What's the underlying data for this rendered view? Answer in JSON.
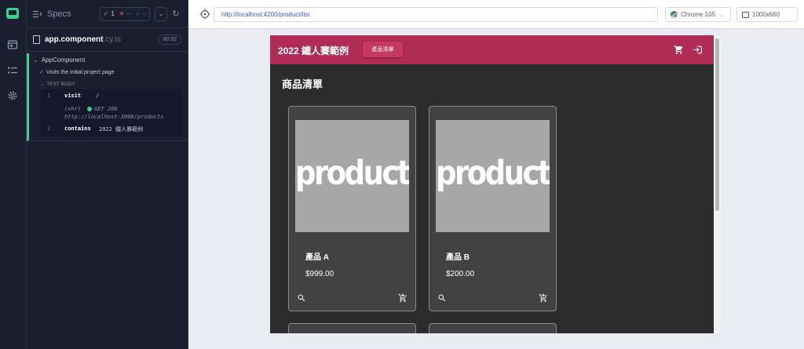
{
  "reporter": {
    "header": {
      "specs_label": "Specs",
      "passed": "1",
      "failed": "--",
      "pending": "--"
    },
    "file": {
      "name": "app.component",
      "ext": ".cy.ts",
      "duration": "00:02"
    },
    "suite": {
      "title": "AppComponent",
      "test": "Visits the initial project page",
      "body_label": "TEST BODY",
      "commands": [
        {
          "num": "1",
          "name": "visit",
          "arg": "/"
        },
        {
          "xhr_tag": "(xhr)",
          "xhr_status": "GET 200",
          "xhr_url": "http://localhost:3000/products"
        },
        {
          "num": "2",
          "name": "contains",
          "arg": "2022 鐵人賽範例"
        }
      ]
    }
  },
  "browserbar": {
    "url": "http://localhost:4200/product/list",
    "browser": "Chrome 105",
    "viewport": "1000x660"
  },
  "app": {
    "title": "2022 鐵人賽範例",
    "nav_button": "產品清單",
    "page_title": "商品清單",
    "products": [
      {
        "image_text": "product",
        "name": "產品 A",
        "price": "$999.00"
      },
      {
        "image_text": "product",
        "name": "產品 B",
        "price": "$200.00"
      }
    ]
  },
  "colors": {
    "toolbar": "#b02c55",
    "pass": "#3ccf8e",
    "fail": "#ef5a6f",
    "reporter_bg": "#1b1e2e"
  },
  "icons": {
    "rail": [
      "runs-icon",
      "spec-list-icon",
      "settings-icon"
    ],
    "toolbar": [
      "cart-icon",
      "login-icon"
    ],
    "card": [
      "search-icon",
      "add-to-cart-icon"
    ]
  }
}
